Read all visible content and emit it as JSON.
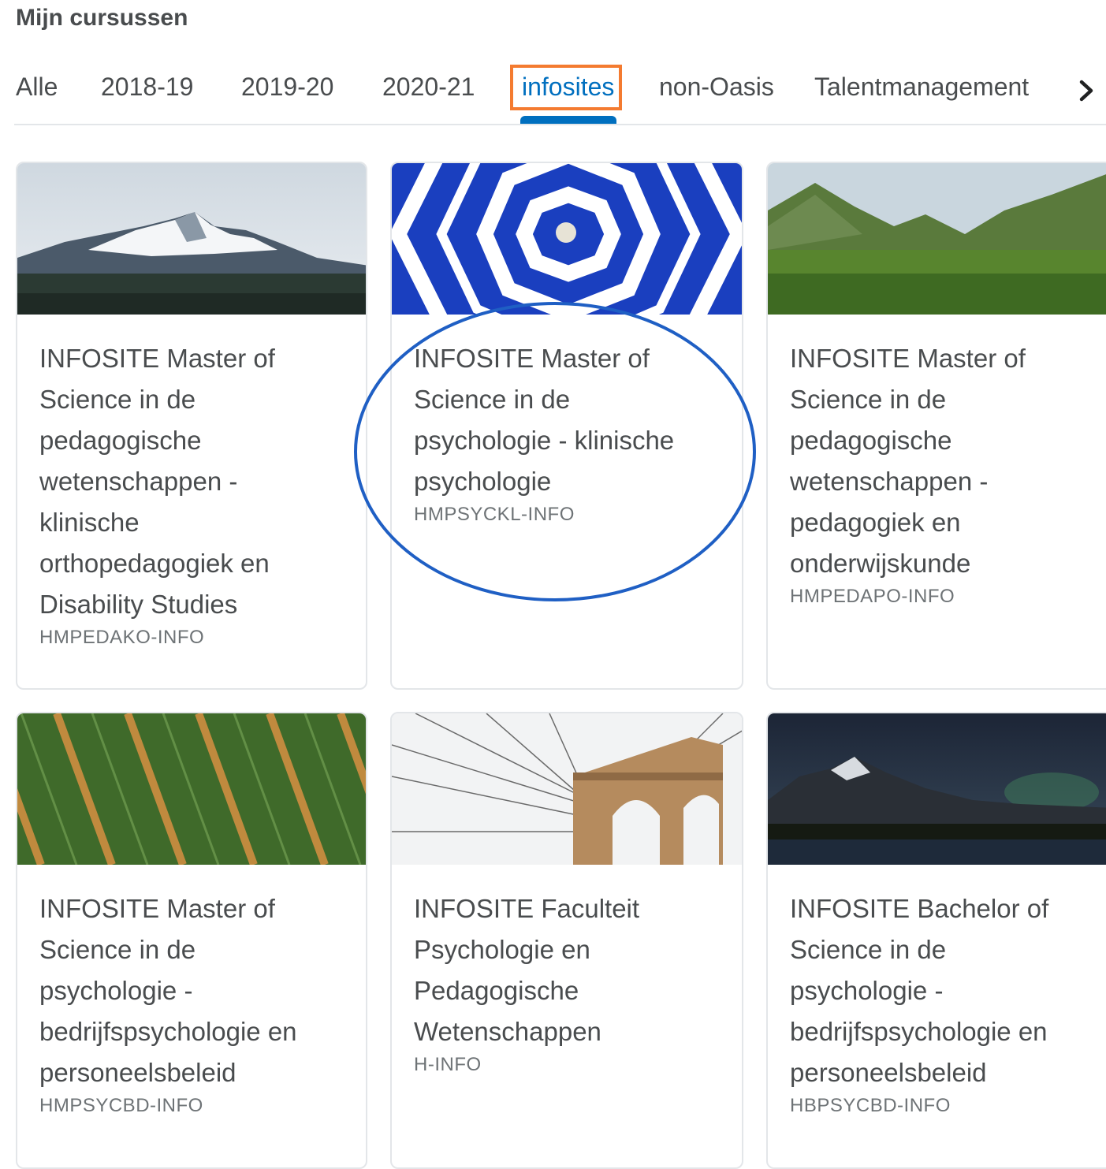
{
  "header": {
    "title": "Mijn cursussen"
  },
  "tabs": [
    {
      "label": "Alle"
    },
    {
      "label": "2018-19"
    },
    {
      "label": "2019-20"
    },
    {
      "label": "2020-21"
    },
    {
      "label": "infosites",
      "active": true
    },
    {
      "label": "non-Oasis"
    },
    {
      "label": "Talentmanagement"
    }
  ],
  "scroll_next_icon": "chevron-right-icon",
  "colors": {
    "accent": "#006fbf",
    "highlight_box": "#f47b30",
    "annotation_circle": "#1f5fc4"
  },
  "courses": [
    {
      "title": "INFOSITE Master of Science in de pedagogische wetenschappen - klinische orthopedagogiek en Disability Studies",
      "code": "HMPEDAKO-INFO",
      "image": "snowy-mountain-range"
    },
    {
      "title": "INFOSITE Master of Science in de psychologie - klinische psychologie",
      "code": "HMPSYCKL-INFO",
      "image": "blue-white-striped-umbrella"
    },
    {
      "title": "INFOSITE Master of Science in de pedagogische wetenschappen - pedagogiek en onderwijskunde",
      "code": "HMPEDAPO-INFO",
      "image": "green-mountain-valley"
    },
    {
      "title": "INFOSITE Master of Science in de psychologie - bedrijfspsychologie en personeelsbeleid",
      "code": "HMPSYCBD-INFO",
      "image": "crop-field-rows"
    },
    {
      "title": "INFOSITE Faculteit Psychologie en Pedagogische Wetenschappen",
      "code": "H-INFO",
      "image": "suspension-bridge-cables"
    },
    {
      "title": "INFOSITE Bachelor of Science in de psychologie - bedrijfspsychologie en personeelsbeleid",
      "code": "HBPSYCBD-INFO",
      "image": "night-mountain-lake"
    }
  ]
}
